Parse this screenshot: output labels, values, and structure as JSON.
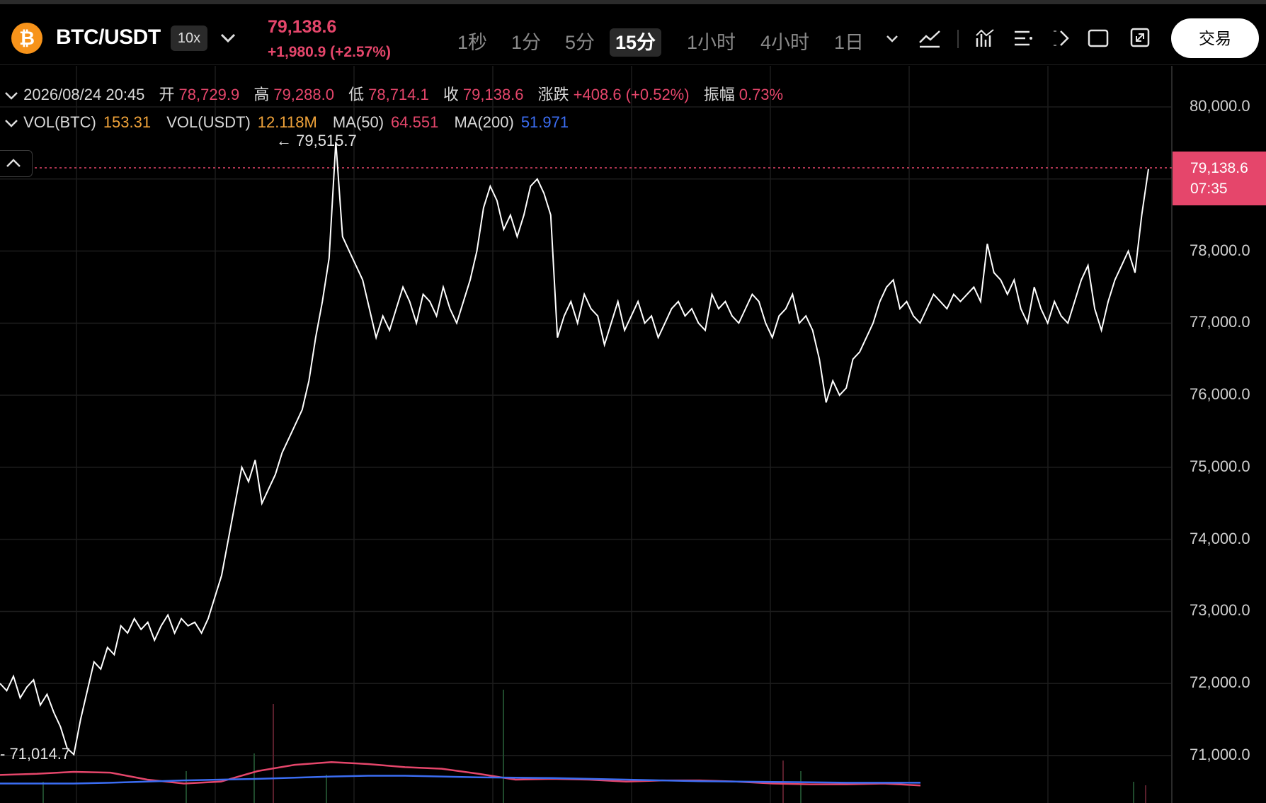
{
  "header": {
    "coin_symbol": "₿",
    "pair": "BTC/USDT",
    "leverage": "10x",
    "last_price": "79,138.6",
    "change_text": "+1,980.9 (+2.57%)",
    "timeframes": [
      "1秒",
      "1分",
      "5分",
      "15分",
      "1小时",
      "4小时",
      "1日"
    ],
    "active_timeframe": "15分",
    "trade_button": "交易"
  },
  "ohlc": {
    "datetime": "2026/08/24 20:45",
    "open_label": "开",
    "open": "78,729.9",
    "high_label": "高",
    "high": "79,288.0",
    "low_label": "低",
    "low": "78,714.1",
    "close_label": "收",
    "close": "79,138.6",
    "change_label": "涨跌",
    "change": "+408.6 (+0.52%)",
    "amplitude_label": "振幅",
    "amplitude": "0.73%"
  },
  "volume": {
    "vol_btc_label": "VOL(BTC)",
    "vol_btc": "153.31",
    "vol_usdt_label": "VOL(USDT)",
    "vol_usdt": "12.118M",
    "ma50_label": "MA(50)",
    "ma50": "64.551",
    "ma200_label": "MA(200)",
    "ma200": "51.971"
  },
  "markers": {
    "high": "← 79,515.7",
    "low": "- 71,014.7"
  },
  "price_tag": {
    "price": "79,138.6",
    "countdown": "07:35"
  },
  "colors": {
    "up": "#e5466b",
    "accent_orange": "#f0a33a",
    "ma200_blue": "#3b6df2",
    "line": "#ffffff"
  },
  "chart_data": {
    "type": "line",
    "ylim": [
      70400,
      80700
    ],
    "y_ticks": [
      "80,000.0",
      "78,000.0",
      "77,000.0",
      "76,000.0",
      "75,000.0",
      "74,000.0",
      "73,000.0",
      "72,000.0",
      "71,000.0"
    ],
    "y_tick_values": [
      80000,
      78000,
      77000,
      76000,
      75000,
      74000,
      73000,
      72000,
      71000
    ],
    "series": [
      {
        "values": [
          72000,
          71900,
          72100,
          71800,
          71950,
          72050,
          71700,
          71850,
          71600,
          71400,
          71100,
          71014.7,
          71500,
          71900,
          72300,
          72200,
          72500,
          72400,
          72800,
          72700,
          72900,
          72750,
          72850,
          72600,
          72800,
          72950,
          72700,
          72900,
          72800,
          72850,
          72700,
          72900,
          73200,
          73500,
          74000,
          74500,
          75000,
          74800,
          75100,
          74500,
          74700,
          74900,
          75200,
          75400,
          75600,
          75800,
          76200,
          76800,
          77300,
          77900,
          79515.7,
          78200,
          78000,
          77800,
          77600,
          77200,
          76800,
          77100,
          76900,
          77200,
          77500,
          77300,
          77000,
          77400,
          77300,
          77100,
          77500,
          77200,
          77000,
          77300,
          77600,
          78000,
          78600,
          78900,
          78700,
          78300,
          78500,
          78200,
          78500,
          78900,
          79000,
          78800,
          78500,
          76800,
          77100,
          77300,
          77000,
          77400,
          77200,
          77100,
          76700,
          77000,
          77300,
          76900,
          77100,
          77300,
          77000,
          77100,
          76800,
          77000,
          77200,
          77300,
          77100,
          77200,
          77000,
          76900,
          77400,
          77200,
          77300,
          77100,
          77000,
          77200,
          77400,
          77300,
          77000,
          76800,
          77100,
          77200,
          77400,
          77000,
          77100,
          76900,
          76500,
          75900,
          76200,
          76000,
          76100,
          76500,
          76600,
          76800,
          77000,
          77300,
          77500,
          77600,
          77200,
          77300,
          77100,
          77000,
          77200,
          77400,
          77300,
          77200,
          77400,
          77300,
          77400,
          77500,
          77300,
          78100,
          77700,
          77600,
          77400,
          77600,
          77200,
          77000,
          77500,
          77200,
          77000,
          77300,
          77100,
          77000,
          77300,
          77600,
          77800,
          77200,
          76900,
          77300,
          77600,
          77800,
          78000,
          77700,
          78500,
          79138.6
        ]
      },
      {
        "name": "MA(50)",
        "values": [
          72,
          75,
          80,
          78,
          60,
          50,
          55,
          82,
          98,
          105,
          100,
          92,
          88,
          75,
          60,
          62,
          60,
          55,
          58,
          58,
          55,
          50,
          48,
          48,
          50,
          45
        ]
      },
      {
        "name": "MA(200)",
        "values": [
          50,
          50,
          50,
          52,
          55,
          58,
          60,
          62,
          65,
          68,
          70,
          70,
          68,
          66,
          65,
          64,
          62,
          60,
          58,
          56,
          55,
          54,
          53,
          52,
          52,
          52
        ]
      }
    ]
  }
}
